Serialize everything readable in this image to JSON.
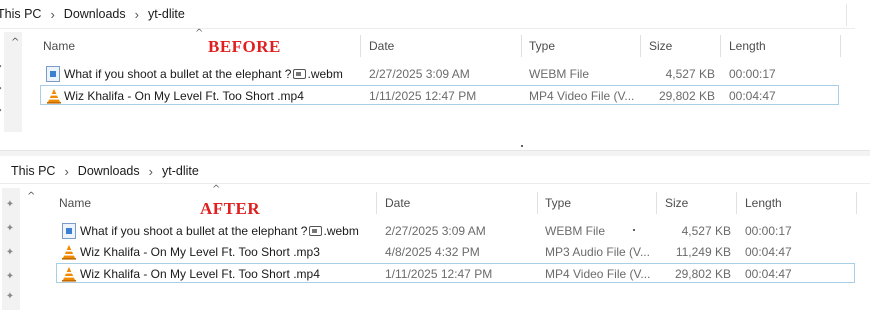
{
  "before": {
    "label": "BEFORE",
    "breadcrumb": [
      "This PC",
      "Downloads",
      "yt-dlite"
    ],
    "columns": {
      "name": "Name",
      "date": "Date",
      "type": "Type",
      "size": "Size",
      "length": "Length"
    },
    "files": [
      {
        "name_pre": "What if you shoot a bullet at the elephant ?",
        "name_post": ".webm",
        "date": "2/27/2025 3:09 AM",
        "type": "WEBM File",
        "size": "4,527 KB",
        "length": "00:00:17",
        "icon": "webm-file-icon"
      },
      {
        "name": "Wiz Khalifa - On My Level Ft. Too Short .mp4",
        "date": "1/11/2025 12:47 PM",
        "type": "MP4 Video File (V...",
        "size": "29,802 KB",
        "length": "00:04:47",
        "icon": "vlc-cone-icon"
      }
    ]
  },
  "after": {
    "label": "AFTER",
    "breadcrumb": [
      "This PC",
      "Downloads",
      "yt-dlite"
    ],
    "columns": {
      "name": "Name",
      "date": "Date",
      "type": "Type",
      "size": "Size",
      "length": "Length"
    },
    "files": [
      {
        "name_pre": "What if you shoot a bullet at the elephant ?",
        "name_post": ".webm",
        "date": "2/27/2025 3:09 AM",
        "type": "WEBM File",
        "size": "4,527 KB",
        "length": "00:00:17",
        "icon": "webm-file-icon"
      },
      {
        "name": "Wiz Khalifa - On My Level Ft. Too Short .mp3",
        "date": "4/8/2025 4:32 PM",
        "type": "MP3 Audio File (V...",
        "size": "11,249 KB",
        "length": "00:04:47",
        "icon": "vlc-cone-icon"
      },
      {
        "name": "Wiz Khalifa - On My Level Ft. Too Short .mp4",
        "date": "1/11/2025 12:47 PM",
        "type": "MP4 Video File (V...",
        "size": "29,802 KB",
        "length": "00:04:47",
        "icon": "vlc-cone-icon"
      }
    ]
  },
  "icons": {
    "breadcrumb_separator": "chevron-right-icon",
    "pin": "pin-icon",
    "sort": "sort-caret-icon"
  },
  "colors": {
    "label_red": "#e02020",
    "selection_border": "#a8cfe6",
    "vlc_orange": "#f08a00"
  }
}
